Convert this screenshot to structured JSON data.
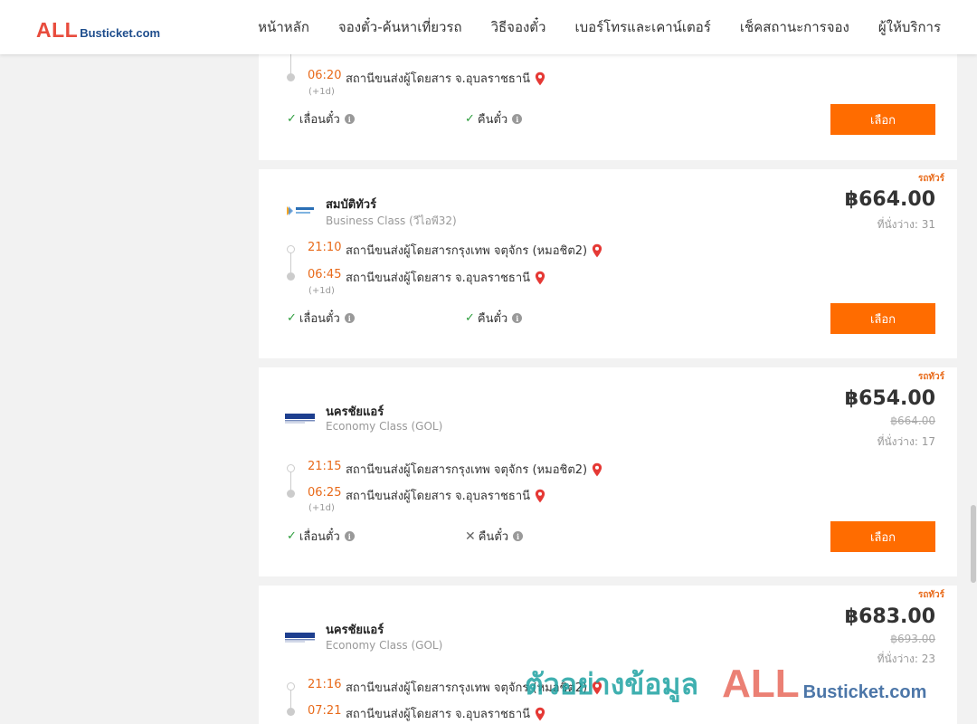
{
  "header": {
    "logo_all": "ALL",
    "logo_rest": "Busticket.com",
    "nav": [
      "หน้าหลัก",
      "จองตั๋ว-ค้นหาเที่ยวรถ",
      "วิธีจองตั๋ว",
      "เบอร์โทรและเคาน์เตอร์",
      "เช็คสถานะการจอง",
      "ผู้ให้บริการ"
    ]
  },
  "card0": {
    "arrive_time": "06:20",
    "arrive_station": "สถานีขนส่งผู้โดยสาร จ.อุบลราชธานี",
    "plus_day": "(+1d)",
    "feat_change": "เลื่อนตั๋ว",
    "feat_refund": "คืนตั๋ว",
    "select": "เลือก"
  },
  "card1": {
    "tag": "รถทัวร์",
    "operator": "สมบัติทัวร์",
    "class": "Business Class (วีไอพี32)",
    "price": "฿664.00",
    "seats": "ที่นั่งว่าง: 31",
    "depart_time": "21:10",
    "depart_station": "สถานีขนส่งผู้โดยสารกรุงเทพ จตุจักร (หมอชิต2)",
    "arrive_time": "06:45",
    "arrive_station": "สถานีขนส่งผู้โดยสาร จ.อุบลราชธานี",
    "plus_day": "(+1d)",
    "feat_change": "เลื่อนตั๋ว",
    "feat_refund": "คืนตั๋ว",
    "select": "เลือก"
  },
  "card2": {
    "tag": "รถทัวร์",
    "operator": "นครชัยแอร์",
    "class": "Economy Class (GOL)",
    "price": "฿654.00",
    "old_price": "฿664.00",
    "seats": "ที่นั่งว่าง: 17",
    "depart_time": "21:15",
    "depart_station": "สถานีขนส่งผู้โดยสารกรุงเทพ จตุจักร (หมอชิต2)",
    "arrive_time": "06:25",
    "arrive_station": "สถานีขนส่งผู้โดยสาร จ.อุบลราชธานี",
    "plus_day": "(+1d)",
    "feat_change": "เลื่อนตั๋ว",
    "feat_refund": "คืนตั๋ว",
    "select": "เลือก"
  },
  "card3": {
    "tag": "รถทัวร์",
    "operator": "นครชัยแอร์",
    "class": "Economy Class (GOL)",
    "price": "฿683.00",
    "old_price": "฿693.00",
    "seats": "ที่นั่งว่าง: 23",
    "depart_time": "21:16",
    "depart_station": "สถานีขนส่งผู้โดยสารกรุงเทพ จตุจักร (หมอชิต2)",
    "arrive_time": "07:21",
    "arrive_station": "สถานีขนส่งผู้โดยสาร จ.อุบลราชธานี"
  },
  "watermark": {
    "text": "ตัวอย่างข้อมูล",
    "all": "ALL",
    "rest": "Busticket.com"
  },
  "colors": {
    "accent": "#ff6c00",
    "time": "#e86a1a",
    "check": "#2e9e3e",
    "pin": "#e53935"
  }
}
